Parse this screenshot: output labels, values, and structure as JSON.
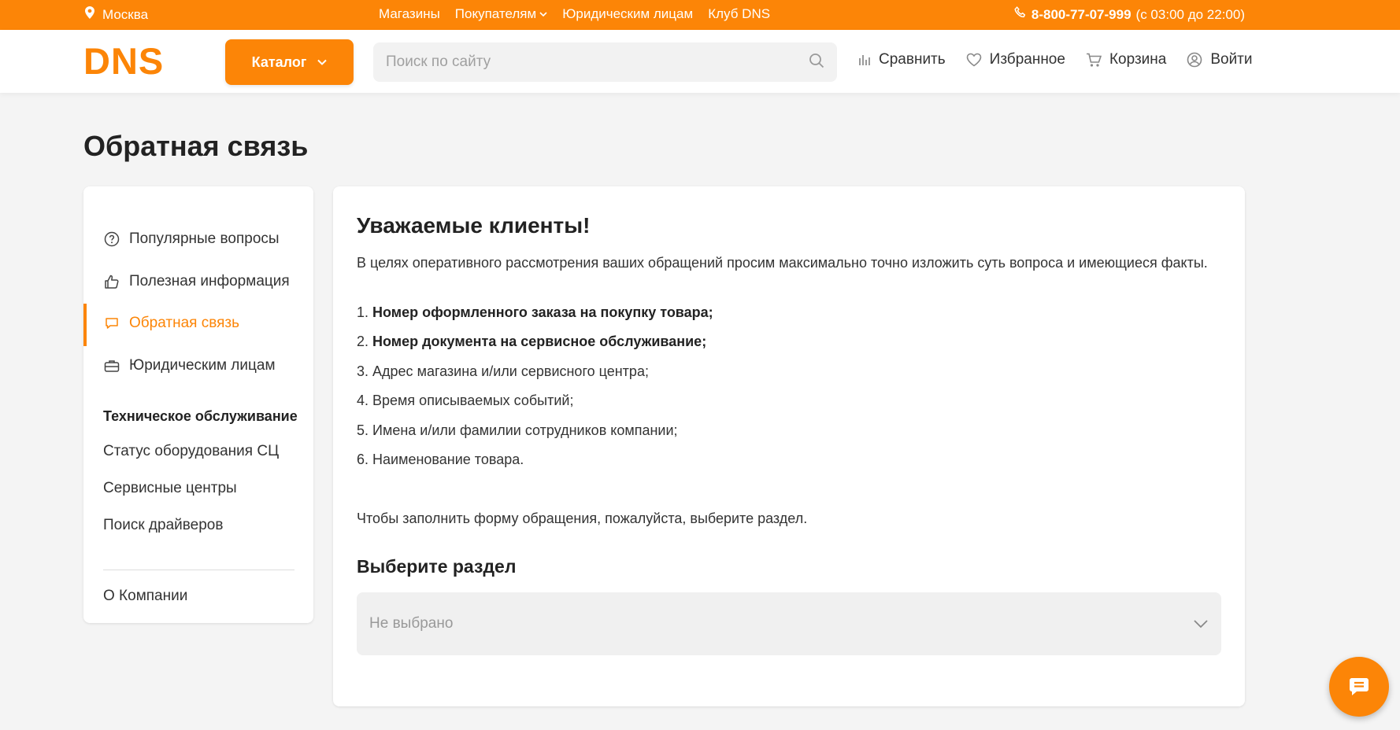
{
  "topbar": {
    "city": "Москва",
    "links": [
      "Магазины",
      "Покупателям",
      "Юридическим лицам",
      "Клуб DNS"
    ],
    "phone": "8-800-77-07-999",
    "hours": "(с 03:00 до 22:00)"
  },
  "header": {
    "logo_text": "DNS",
    "catalog_label": "Каталог",
    "search_placeholder": "Поиск по сайту",
    "actions": {
      "compare": "Сравнить",
      "favorites": "Избранное",
      "cart": "Корзина",
      "login": "Войти"
    }
  },
  "page_title": "Обратная связь",
  "sidebar": {
    "items": [
      {
        "label": "Популярные вопросы",
        "icon": "question-icon"
      },
      {
        "label": "Полезная информация",
        "icon": "thumbs-up-icon"
      },
      {
        "label": "Обратная связь",
        "icon": "chat-bubble-icon",
        "active": true
      },
      {
        "label": "Юридическим лицам",
        "icon": "briefcase-icon"
      }
    ],
    "heading": "Техническое обслуживание",
    "links": [
      "Статус оборудования СЦ",
      "Сервисные центры",
      "Поиск драйверов"
    ],
    "about": "О Компании"
  },
  "main": {
    "title": "Уважаемые клиенты!",
    "intro": "В целях оперативного рассмотрения ваших обращений просим максимально точно изложить суть вопроса и имеющиеся факты.",
    "list": [
      {
        "num": "1.",
        "text": "Номер оформленного заказа на покупку товара;",
        "bold": true
      },
      {
        "num": "2.",
        "text": "Номер документа на сервисное обслуживание;",
        "bold": true
      },
      {
        "num": "3.",
        "text": "Адрес магазина и/или сервисного центра;",
        "bold": false
      },
      {
        "num": "4.",
        "text": "Время описываемых событий;",
        "bold": false
      },
      {
        "num": "5.",
        "text": "Имена и/или фамилии сотрудников компании;",
        "bold": false
      },
      {
        "num": "6.",
        "text": "Наименование товара.",
        "bold": false
      }
    ],
    "outro": "Чтобы заполнить форму обращения, пожалуйста, выберите раздел.",
    "section_title": "Выберите раздел",
    "select_value": "Не выбрано"
  },
  "colors": {
    "accent": "#fc8507",
    "background": "#f4f4f4"
  }
}
